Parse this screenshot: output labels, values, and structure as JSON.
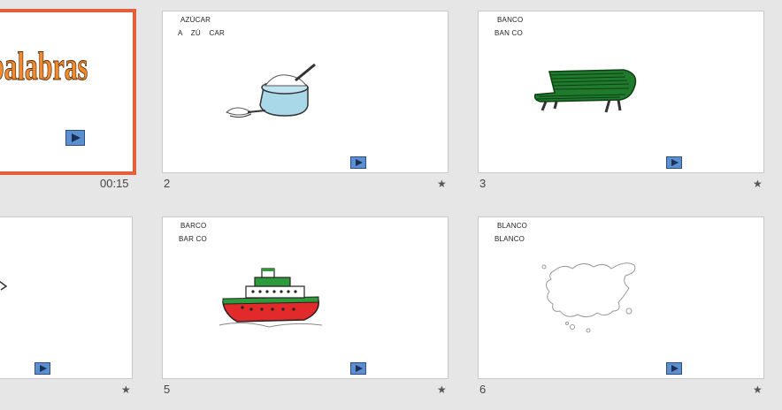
{
  "slides": [
    {
      "title_word": "palabras",
      "time": "00:15"
    },
    {
      "number": "2",
      "line1": "AZÚCAR",
      "line2": "A    ZÚ    CAR"
    },
    {
      "number": "3",
      "line1": "BANCO",
      "line2": "BAN CO"
    },
    {
      "number": "5",
      "line1": "BARCO",
      "line2": "BAR CO"
    },
    {
      "number": "6",
      "line1": "BLANCO",
      "line2": "BLANCO"
    }
  ],
  "colors": {
    "selection": "#e2603a",
    "play_button": "#5b8fd0"
  },
  "icons": {
    "star": "★",
    "play": "play-button-icon"
  }
}
